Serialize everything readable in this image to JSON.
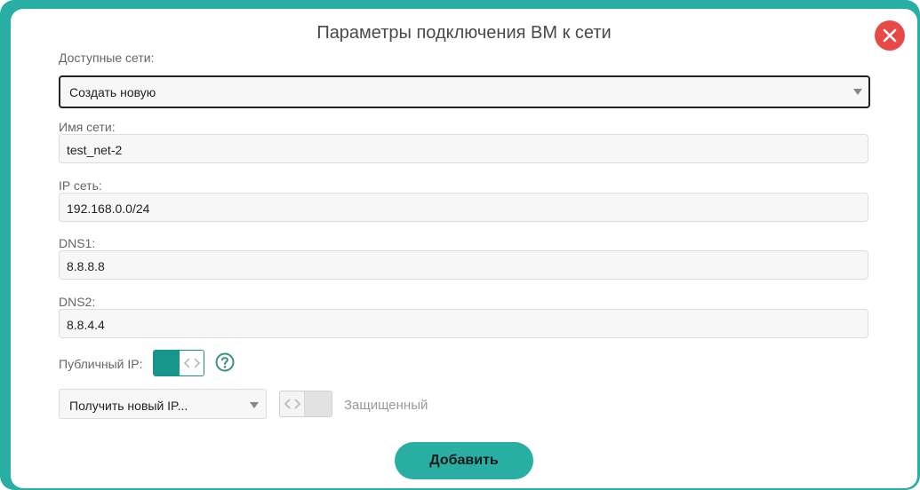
{
  "dialog": {
    "title": "Параметры подключения ВМ к сети"
  },
  "available_networks": {
    "label": "Доступные сети:",
    "selected": "Создать новую"
  },
  "network_name": {
    "label": "Имя сети:",
    "value": "test_net-2"
  },
  "ip_network": {
    "label": "IP сеть:",
    "value": "192.168.0.0/24"
  },
  "dns1": {
    "label": "DNS1:",
    "value": "8.8.8.8"
  },
  "dns2": {
    "label": "DNS2:",
    "value": "8.8.4.4"
  },
  "public_ip": {
    "label": "Публичный IP:",
    "enabled": true,
    "help_icon": "question-circle-icon"
  },
  "ip_select": {
    "selected": "Получить новый IP..."
  },
  "protected": {
    "label": "Защищенный",
    "enabled": false
  },
  "actions": {
    "add_label": "Добавить"
  },
  "colors": {
    "accent": "#28aea3",
    "toggle_on": "#17968b",
    "close": "#e84848"
  }
}
